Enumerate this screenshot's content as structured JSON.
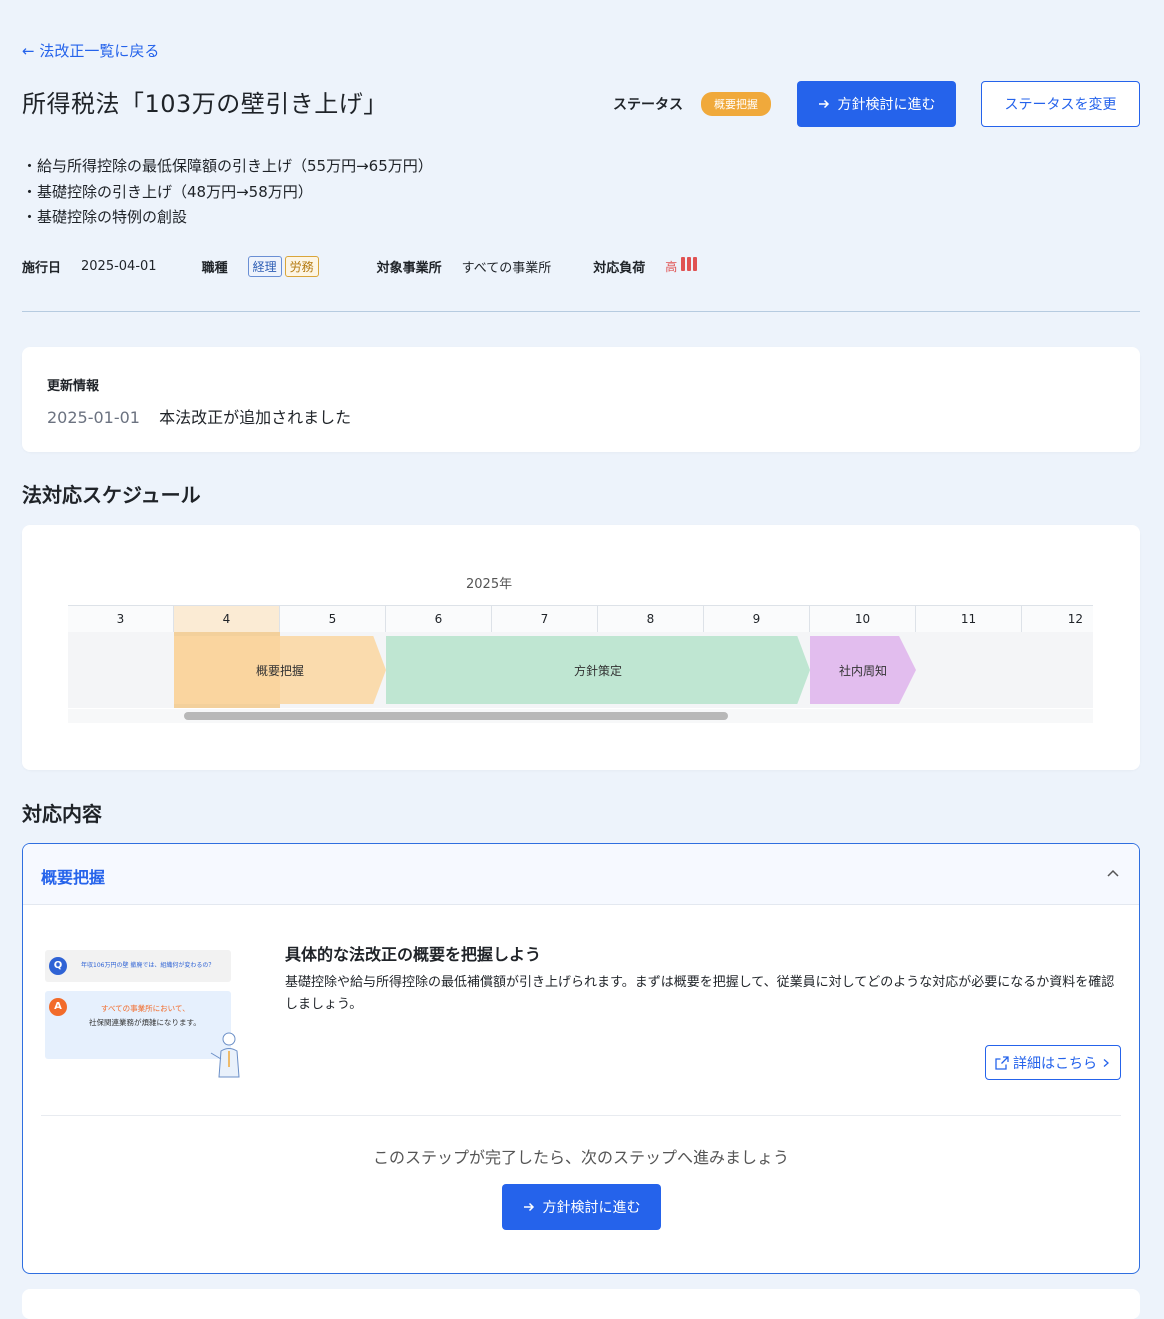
{
  "back_link": "← 法改正一覧に戻る",
  "title": "所得税法「103万の壁引き上げ」",
  "status": {
    "label": "ステータス",
    "badge": "概要把握",
    "next_button": "方針検討に進む",
    "change_button": "ステータスを変更"
  },
  "summary": [
    "・給与所得控除の最低保障額の引き上げ（55万円→65万円）",
    "・基礎控除の引き上げ（48万円→58万円）",
    "・基礎控除の特例の創設"
  ],
  "meta": {
    "effective_label": "施行日",
    "effective_date": "2025-04-01",
    "job_label": "職種",
    "job_tags": [
      "経理",
      "労務"
    ],
    "office_label": "対象事業所",
    "office_value": "すべての事業所",
    "load_label": "対応負荷",
    "load_value": "高",
    "load_level": 3
  },
  "update": {
    "heading": "更新情報",
    "date": "2025-01-01",
    "text": "本法改正が追加されました"
  },
  "schedule": {
    "title": "法対応スケジュール",
    "year": "2025年",
    "months": [
      "3",
      "4",
      "5",
      "6",
      "7",
      "8",
      "9",
      "10",
      "11",
      "12"
    ],
    "current_month": "4",
    "phases": [
      {
        "label": "概要把握",
        "start": "4",
        "end": "5",
        "color": "#fad6a0"
      },
      {
        "label": "方針策定",
        "start": "6",
        "end": "9",
        "color": "#bfe6d2"
      },
      {
        "label": "社内周知",
        "start": "10",
        "end": "10",
        "color": "#e2bdee"
      }
    ]
  },
  "content": {
    "title": "対応内容",
    "accordion_title": "概要把握",
    "illustration": {
      "q_letter": "Q",
      "q_text": "年収106万円の壁 撤廃では、組織何が変わるの？",
      "a_letter": "A",
      "a_line1": "すべての事業所において、",
      "a_line2": "社保関連業務が煩雑になります。"
    },
    "heading": "具体的な法改正の概要を把握しよう",
    "description": "基礎控除や給与所得控除の最低補償額が引き上げられます。まずは概要を把握して、従業員に対してどのような対応が必要になるか資料を確認しましょう。",
    "detail_button": "詳細はこちら",
    "step_note": "このステップが完了したら、次のステップへ進みましょう",
    "next_button": "方針検討に進む"
  },
  "colors": {
    "accent": "#2563eb",
    "badge": "#f0a93b",
    "load": "#e05252"
  }
}
